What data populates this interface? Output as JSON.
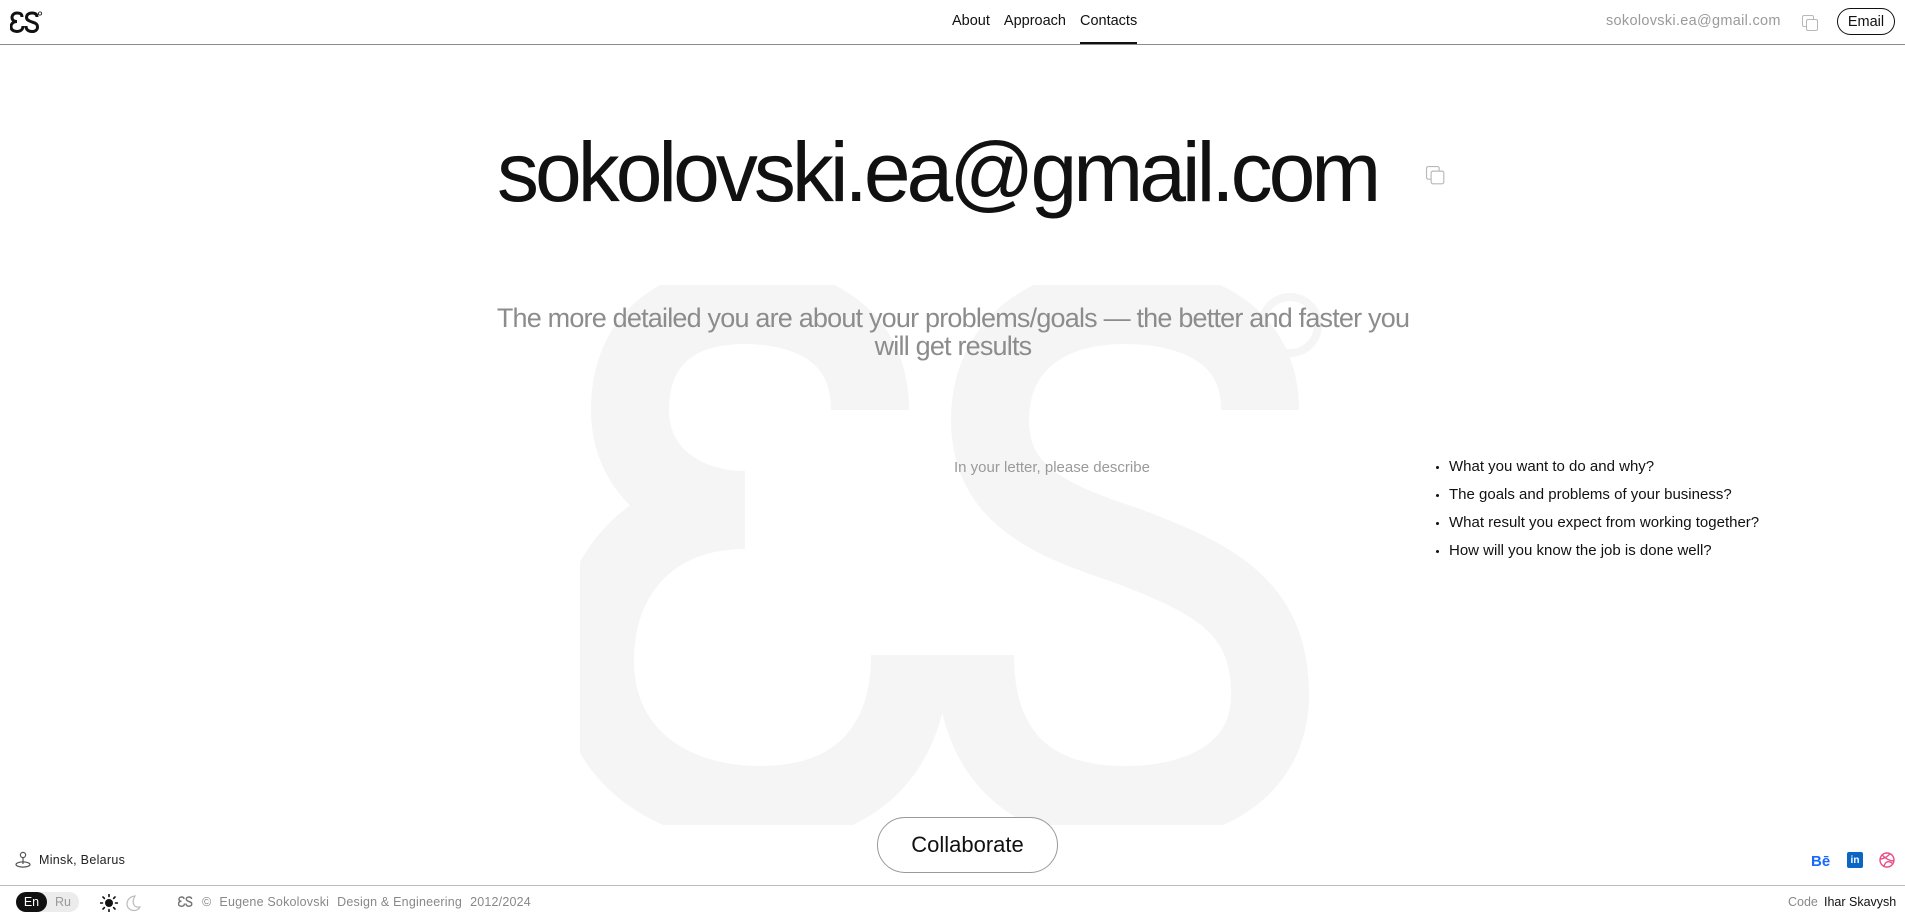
{
  "header": {
    "logo_alt": "eS",
    "nav": [
      {
        "label": "About",
        "active": false
      },
      {
        "label": "Approach",
        "active": false
      },
      {
        "label": "Contacts",
        "active": true
      }
    ],
    "email": "sokolovski.ea@gmail.com",
    "email_button": "Email"
  },
  "main": {
    "email": "sokolovski.ea@gmail.com",
    "subtitle": "The more detailed you are about your problems/goals — the better and faster you will get results",
    "letter_label": "In your letter, please describe",
    "questions": [
      "What you want to do and why?",
      "The goals and problems of your business?",
      "What result you expect from working together?",
      "How will you know the job is done well?"
    ],
    "collaborate_button": "Collaborate"
  },
  "location": "Minsk, Belarus",
  "social": {
    "behance": "Bē",
    "linkedin": "in"
  },
  "footer": {
    "lang_en": "En",
    "lang_ru": "Ru",
    "copyright_symbol": "©",
    "author": "Eugene Sokolovski",
    "role": "Design & Engineering",
    "years": "2012/2024",
    "code_label": "Code",
    "code_author": "Ihar Skavysh"
  },
  "colors": {
    "accent": "#111111",
    "muted": "#8c8c8c",
    "behance": "#1769ff",
    "linkedin": "#0a66c2",
    "dribbble": "#ea4c89"
  },
  "icons": [
    "es-logo-icon",
    "copy-icon",
    "location-pin-icon",
    "behance-icon",
    "linkedin-icon",
    "dribbble-icon",
    "sun-icon",
    "moon-icon"
  ]
}
